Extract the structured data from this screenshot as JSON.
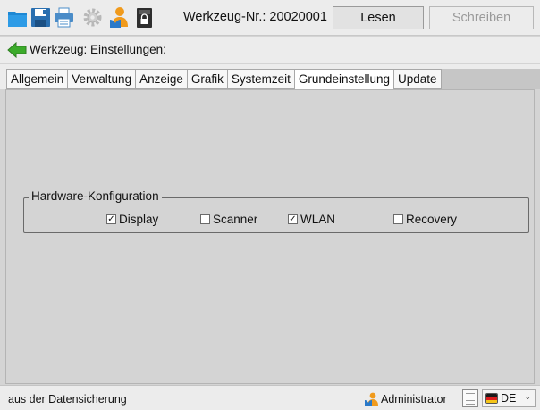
{
  "toolbar": {
    "icons": [
      "folder-icon",
      "save-icon",
      "print-icon",
      "settings-icon",
      "user-icon",
      "lock-icon"
    ],
    "title": "Werkzeug-Nr.: 20020001",
    "read_label": "Lesen",
    "write_label": "Schreiben"
  },
  "header": {
    "subtitle": "Werkzeug: Einstellungen:"
  },
  "tabs": [
    {
      "label": "Allgemein",
      "active": false
    },
    {
      "label": "Verwaltung",
      "active": false
    },
    {
      "label": "Anzeige",
      "active": false
    },
    {
      "label": "Grafik",
      "active": false
    },
    {
      "label": "Systemzeit",
      "active": false
    },
    {
      "label": "Grundeinstellung",
      "active": true
    },
    {
      "label": "Update",
      "active": false
    }
  ],
  "hardware": {
    "title": "Hardware-Konfiguration",
    "options": [
      {
        "label": "Display",
        "checked": true
      },
      {
        "label": "Scanner",
        "checked": false
      },
      {
        "label": "WLAN",
        "checked": true
      },
      {
        "label": "Recovery",
        "checked": false
      }
    ]
  },
  "status": {
    "left_text": "aus der Datensicherung",
    "user": "Administrator",
    "language": "DE"
  },
  "colors": {
    "folder": "#1e88d4",
    "save": "#2a6fb0",
    "arrow": "#3bab2a",
    "arrow_dark": "#2d7d20",
    "user_orange": "#f09a1c",
    "user_blue": "#2a79c9"
  }
}
